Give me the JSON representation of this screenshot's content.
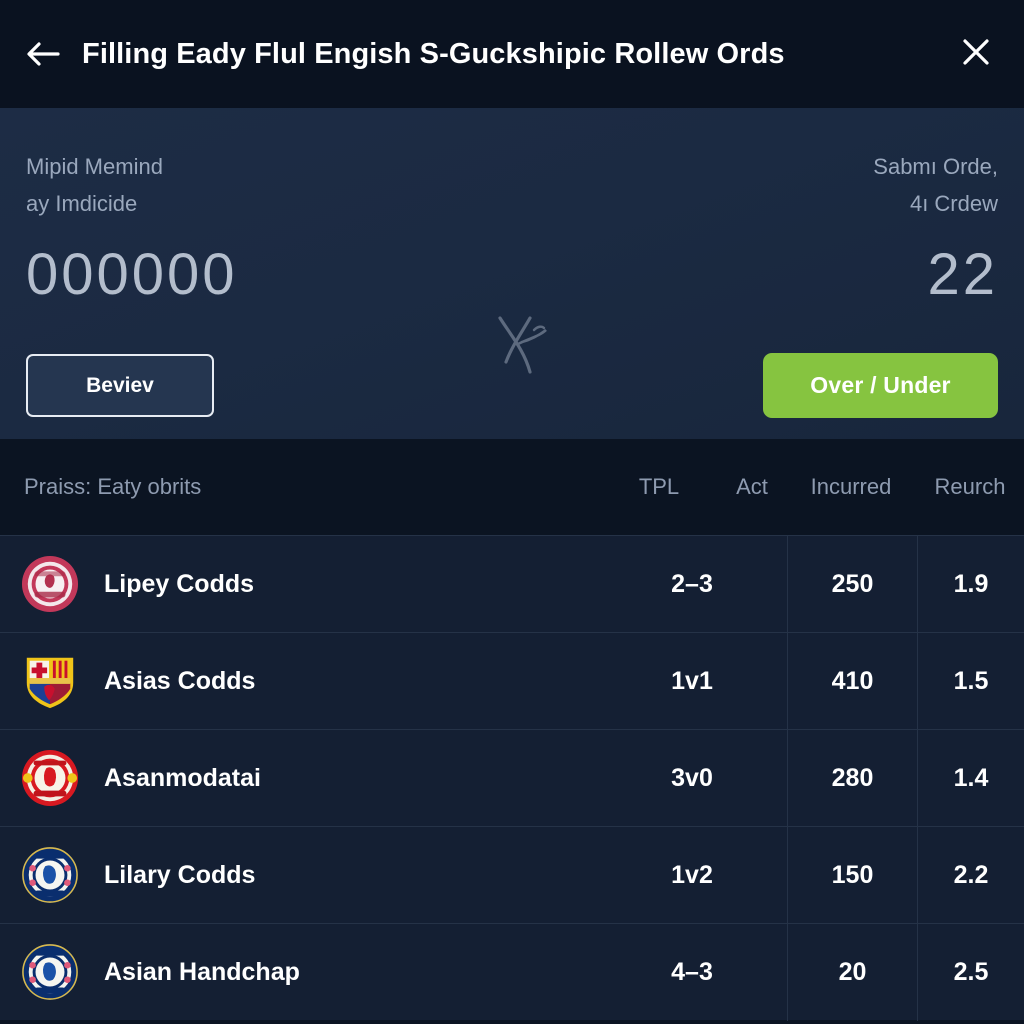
{
  "titlebar": {
    "back_icon": "arrow-left-icon",
    "title": "Filling Eady Flul Engish S-Guckshipic Rollew Ords",
    "close_icon": "close-icon"
  },
  "summary": {
    "watermark_icon": "monogram-watermark-icon",
    "left": {
      "label_line1": "Mipid Memind",
      "label_line2": "ay Imdicide",
      "value": "000000",
      "button_label": "Beviev"
    },
    "right": {
      "label_line1": "Sabmı Orde,",
      "label_line2": "4ı Crdew",
      "value": "22",
      "button_label": "Over / Under",
      "button_color": "#86c440"
    }
  },
  "table": {
    "headers": {
      "name": "Praiss: Eaty obrits",
      "tpl": "TPL",
      "act": "Act",
      "incurred": "Incurred",
      "reurch": "Reurch"
    },
    "rows": [
      {
        "crest": "crest-round-crimson",
        "name": "Lipey Codds",
        "tpl": "2–3",
        "incurred": "250",
        "reurch": "1.9"
      },
      {
        "crest": "crest-shield-blaugrana",
        "name": "Asias Codds",
        "tpl": "1v1",
        "incurred": "410",
        "reurch": "1.5"
      },
      {
        "crest": "crest-round-red",
        "name": "Asanmodatai",
        "tpl": "3v0",
        "incurred": "280",
        "reurch": "1.4"
      },
      {
        "crest": "crest-round-blue",
        "name": "Lilary Codds",
        "tpl": "1v2",
        "incurred": "150",
        "reurch": "2.2"
      },
      {
        "crest": "crest-round-blue",
        "name": "Asian Handchap",
        "tpl": "4–3",
        "incurred": "20",
        "reurch": "2.5"
      }
    ]
  },
  "colors": {
    "titlebar_bg": "#0a1220",
    "panel_bg": "#1b2a42",
    "table_header_bg": "#0b1422",
    "row_bg": "#141f33",
    "row_divider": "#253247",
    "accent_green": "#86c440",
    "muted_text": "#8e9bb0"
  }
}
